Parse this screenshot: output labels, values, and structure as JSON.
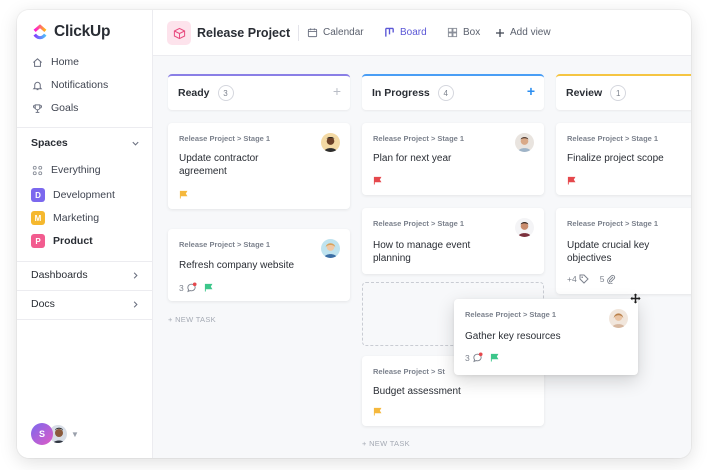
{
  "app": {
    "name": "ClickUp"
  },
  "colors": {
    "accent": "#5b57d6",
    "ready": "#8a7fe6",
    "in_progress": "#4a9ef5",
    "review": "#f5c542",
    "flag_red": "#e5484d",
    "flag_yellow": "#f5b83d",
    "flag_green": "#3cc68a"
  },
  "sidebar": {
    "nav": [
      {
        "label": "Home",
        "icon": "home-icon"
      },
      {
        "label": "Notifications",
        "icon": "bell-icon"
      },
      {
        "label": "Goals",
        "icon": "trophy-icon"
      }
    ],
    "spaces_label": "Spaces",
    "everything_label": "Everything",
    "spaces": [
      {
        "letter": "D",
        "label": "Development",
        "color": "#7b68ee"
      },
      {
        "letter": "M",
        "label": "Marketing",
        "color": "#f5b82e"
      },
      {
        "letter": "P",
        "label": "Product",
        "color": "#f25c8f"
      }
    ],
    "dashboards_label": "Dashboards",
    "docs_label": "Docs",
    "user_initial": "S"
  },
  "header": {
    "project_title": "Release Project",
    "views": [
      {
        "label": "Calendar",
        "icon": "calendar-icon"
      },
      {
        "label": "Board",
        "icon": "board-icon"
      },
      {
        "label": "Box",
        "icon": "box-grid-icon"
      },
      {
        "label": "Add view",
        "icon": "plus-icon"
      }
    ]
  },
  "columns": [
    {
      "title": "Ready",
      "count": "3"
    },
    {
      "title": "In Progress",
      "count": "4"
    },
    {
      "title": "Review",
      "count": "1"
    }
  ],
  "cards": {
    "ready": [
      {
        "crumb": "Release Project > Stage 1",
        "title": "Update contractor agreement"
      },
      {
        "crumb": "Release Project > Stage 1",
        "title": "Refresh company website",
        "comments": "3"
      }
    ],
    "progress": [
      {
        "crumb": "Release Project > Stage 1",
        "title": "Plan for next year"
      },
      {
        "crumb": "Release Project > Stage 1",
        "title": "How to manage event planning"
      },
      {
        "crumb": "Release Project > St",
        "title": "Budget assessment"
      }
    ],
    "review": [
      {
        "crumb": "Release Project > Stage 1",
        "title": "Finalize project scope"
      },
      {
        "crumb": "Release Project > Stage 1",
        "title": "Update crucial key objectives",
        "tags": "+4",
        "attachments": "5"
      }
    ],
    "dragging": {
      "crumb": "Release Project > Stage 1",
      "title": "Gather key resources",
      "comments": "3"
    }
  },
  "new_task_label": "+ NEW TASK"
}
